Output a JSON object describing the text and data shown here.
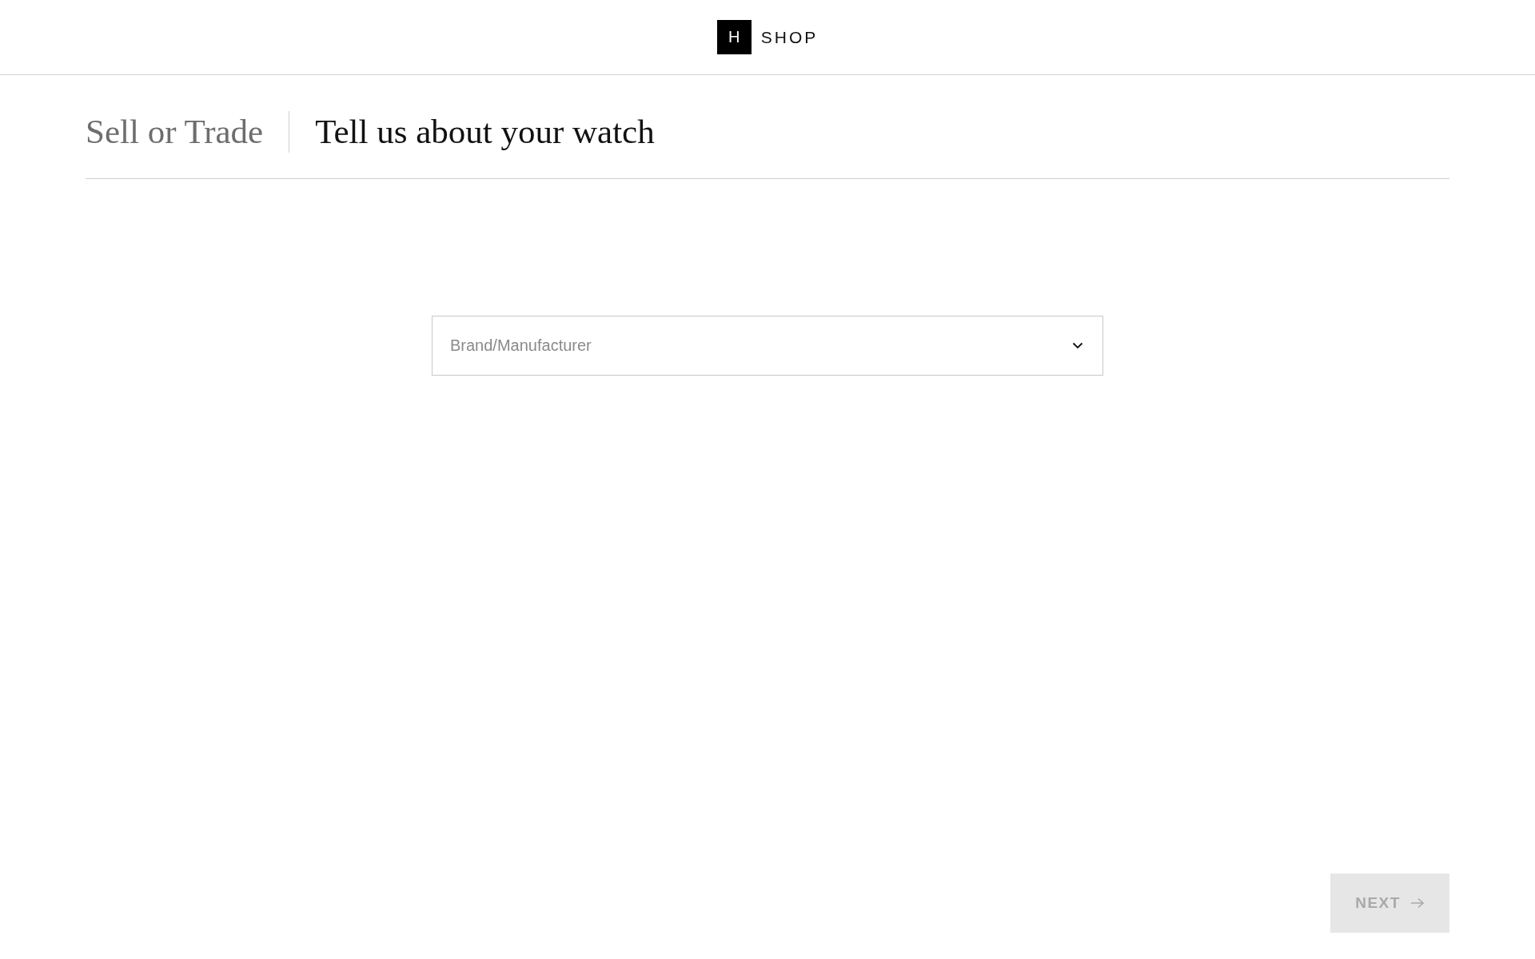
{
  "header": {
    "logo_mark": "H",
    "logo_text": "SHOP"
  },
  "breadcrumb": {
    "section": "Sell or Trade",
    "title": "Tell us about your watch"
  },
  "brand_select": {
    "placeholder": "Brand/Manufacturer"
  },
  "next_button": {
    "label": "NEXT",
    "disabled": true
  }
}
